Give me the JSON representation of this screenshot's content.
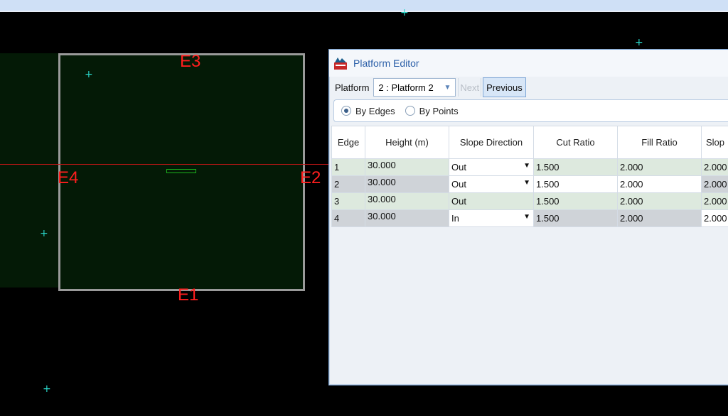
{
  "dialog": {
    "title": "Platform Editor",
    "platform_label": "Platform",
    "platform_value": "2 : Platform 2",
    "next_label": "Next",
    "previous_label": "Previous",
    "mode_options": [
      "By Edges",
      "By Points"
    ],
    "mode_selected": "By Edges",
    "table": {
      "headers": [
        "Edge",
        "Height (m)",
        "Slope Direction",
        "Cut Ratio",
        "Fill Ratio",
        "Slop"
      ],
      "rows": [
        {
          "edge": "1",
          "height": "30.000",
          "direction": "Out",
          "cut": "1.500",
          "fill": "2.000",
          "slope": "2.000"
        },
        {
          "edge": "2",
          "height": "30.000",
          "direction": "Out",
          "cut": "1.500",
          "fill": "2.000",
          "slope": "2.000"
        },
        {
          "edge": "3",
          "height": "30.000",
          "direction": "Out",
          "cut": "1.500",
          "fill": "2.000",
          "slope": "2.000"
        },
        {
          "edge": "4",
          "height": "30.000",
          "direction": "In",
          "cut": "1.500",
          "fill": "2.000",
          "slope": "2.000"
        }
      ]
    }
  },
  "canvas": {
    "edge_labels": {
      "e1": "E1",
      "e2": "E2",
      "e3": "E3",
      "e4": "E4"
    }
  },
  "colors": {
    "edge_label": "#ff1e1e",
    "region_fill": "#041a06",
    "accent": "#2b5fa8"
  }
}
